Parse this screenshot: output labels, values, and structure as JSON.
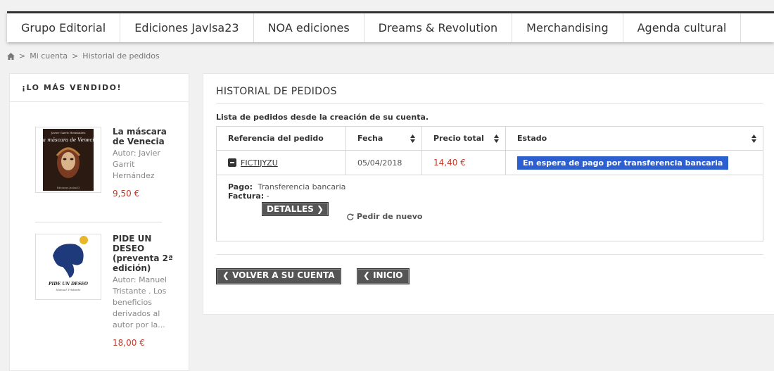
{
  "nav": {
    "items": [
      "Grupo Editorial",
      "Ediciones JavIsa23",
      "NOA ediciones",
      "Dreams & Revolution",
      "Merchandising",
      "Agenda cultural"
    ]
  },
  "breadcrumb": {
    "home_icon": "home-icon",
    "items": [
      "Mi cuenta",
      "Historial de pedidos"
    ],
    "separator": ">"
  },
  "sidebar": {
    "title": "¡LO MÁS VENDIDO!",
    "products": [
      {
        "name": "La máscara de Venecia",
        "author": "Autor: Javier Garrit Hernández",
        "price": "9,50 €",
        "cover_text": [
          "Javier Garrit Hernández",
          "La máscara de Venecia",
          "Ediciones JavIsa23"
        ]
      },
      {
        "name": "PIDE UN DESEO (preventa 2ª edición)",
        "author": "Autor: Manuel Tristante . Los beneficios derivados al autor por la...",
        "price": "18,00 €",
        "cover_text": [
          "PIDE UN DESEO",
          "Manuel Tristante"
        ]
      }
    ]
  },
  "main": {
    "title": "HISTORIAL DE PEDIDOS",
    "list_info": "Lista de pedidos desde la creación de su cuenta.",
    "table": {
      "headers": [
        "Referencia del pedido",
        "Fecha",
        "Precio total",
        "Estado"
      ],
      "rows": [
        {
          "reference": "FICTIJYZU",
          "date": "05/04/2018",
          "total": "14,40 €",
          "status": "En espera de pago por transferencia bancaria"
        }
      ]
    },
    "detail": {
      "payment_label": "Pago:",
      "payment_value": "Transferencia bancaria",
      "invoice_label": "Factura:",
      "invoice_value": "-",
      "details_button": "DETALLES ❯",
      "reorder": "Pedir de nuevo"
    },
    "back_account": "VOLVER A SU CUENTA",
    "home": "INICIO"
  },
  "colors": {
    "status_badge": "#2d5fd0",
    "price": "#c0392b",
    "button": "#555555"
  }
}
